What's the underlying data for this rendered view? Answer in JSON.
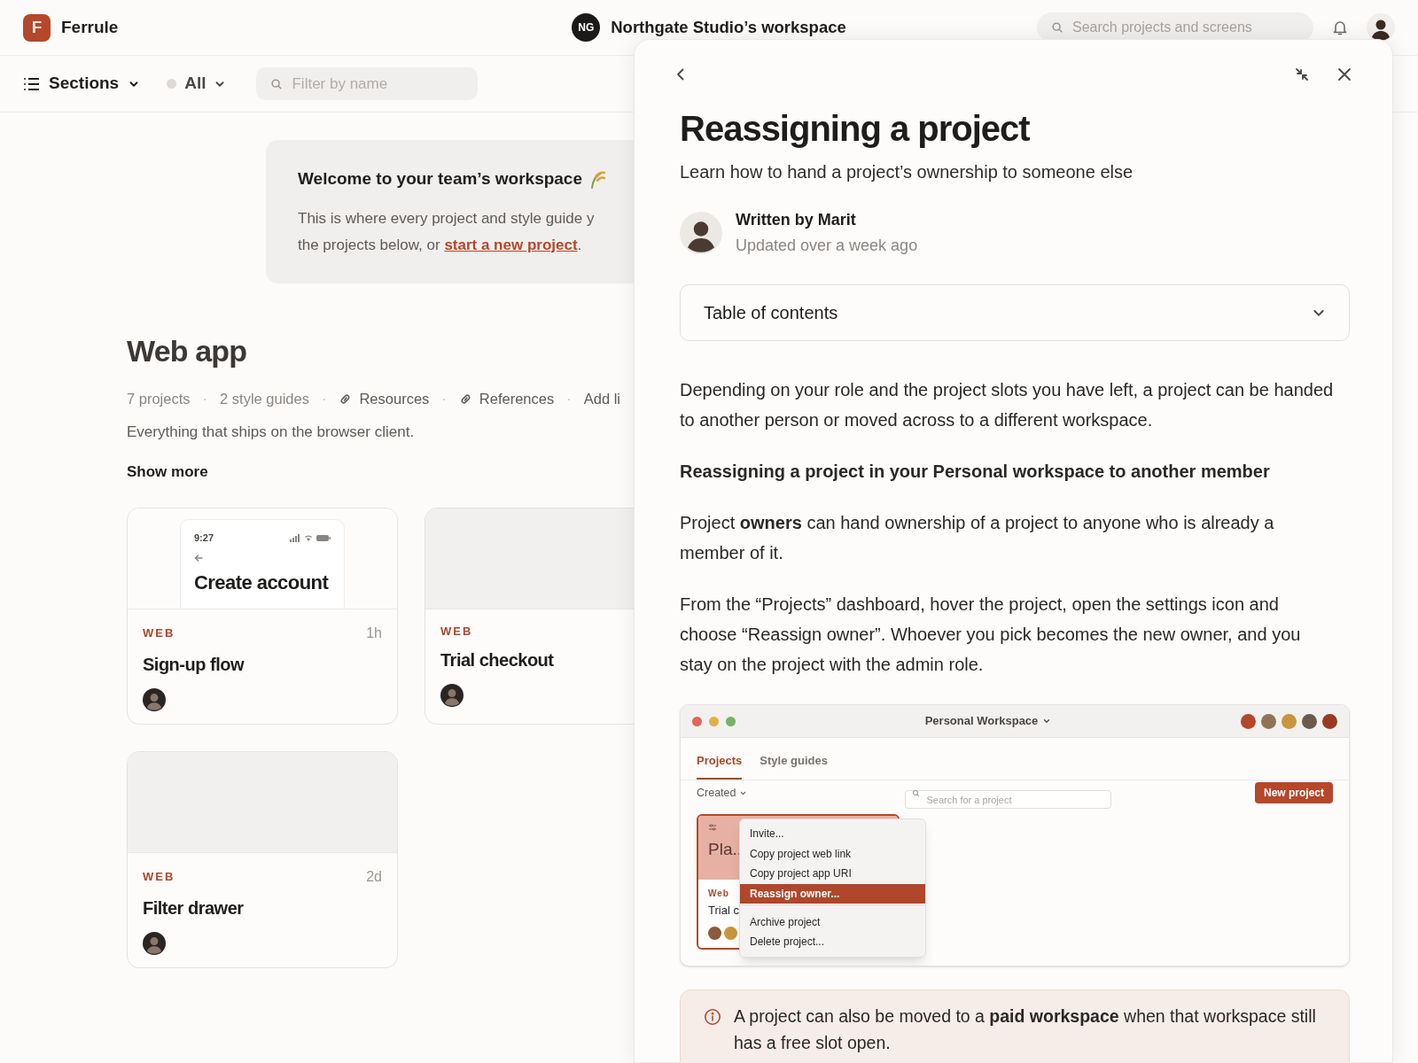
{
  "topbar": {
    "logo_letter": "F",
    "brand": "Ferrule",
    "workspace": {
      "initials": "NG",
      "name": "Northgate Studio’s workspace"
    },
    "search": {
      "placeholder": "Search projects and screens"
    }
  },
  "toolbar": {
    "sections": "Sections",
    "filter": "All",
    "filter_field": {
      "placeholder": "Filter by name"
    }
  },
  "welcome": {
    "title": "Welcome to your team’s workspace",
    "line_1": "This is where every project and style guide y",
    "line_2": "the projects below, or ",
    "link": "start a new project",
    "end": "."
  },
  "section": {
    "title": "Web app",
    "meta": [
      {
        "kind": "count",
        "text": "7 projects"
      },
      {
        "kind": "separator",
        "text": "·"
      },
      {
        "kind": "count",
        "text": "2 style guides"
      },
      {
        "kind": "separator",
        "text": "·"
      },
      {
        "kind": "link",
        "text": "Resources"
      },
      {
        "kind": "separator",
        "text": "·"
      },
      {
        "kind": "link",
        "text": "References"
      },
      {
        "kind": "separator",
        "text": "·"
      },
      {
        "kind": "action",
        "text": "Add li"
      }
    ],
    "description": "Everything that ships on the browser client.",
    "show_more": "Show more"
  },
  "cards": [
    {
      "tag": "WEB",
      "age": "1h",
      "title": "Sign-up flow",
      "preview": {
        "kind": "phone",
        "time": "9:27",
        "heading": "Create account"
      }
    },
    {
      "tag": "WEB",
      "title": "Trial checkout",
      "preview": {
        "kind": "blank"
      }
    },
    {
      "tag": "WEB",
      "age": "2d",
      "title": "Filter drawer",
      "preview": {
        "kind": "blank"
      }
    }
  ],
  "panel": {
    "title": "Reassigning a project",
    "subtitle": "Learn how to hand a project’s ownership to someone else",
    "author": {
      "byline": "Written by Marit",
      "updated": "Updated over a week ago"
    },
    "toc": {
      "label": "Table of contents",
      "expanded": false
    },
    "blocks": [
      {
        "kind": "p",
        "text": "Depending on your role and the project slots you have left, a project can be handed to another person or moved across to a different workspace."
      },
      {
        "kind": "h",
        "text": "Reassigning a project in your Personal workspace to another member"
      },
      {
        "kind": "p",
        "text": "Project **owners** can hand ownership of a project to anyone who is already a member of it."
      },
      {
        "kind": "p",
        "text": "From the “Projects” dashboard, hover the project, open the settings icon and choose “Reassign owner”. Whoever you pick becomes the new owner, and you stay on the project with the admin role."
      },
      {
        "kind": "screenshot"
      }
    ],
    "screenshot": {
      "title": "Personal Workspace",
      "members": [
        {
          "color": "#b5472a"
        },
        {
          "color": "#8f7555"
        },
        {
          "color": "#c9953d"
        },
        {
          "color": "#6b5a4c"
        },
        {
          "color": "#9a3a22"
        }
      ],
      "tabs": [
        {
          "label": "Projects",
          "selected": true
        },
        {
          "label": "Style guides",
          "selected": false
        }
      ],
      "sort": "Created",
      "search": {
        "placeholder": "Search for a project"
      },
      "button": "New project",
      "card": {
        "title": "Pla..",
        "tag": "Web",
        "name": "Trial c",
        "members": [
          {
            "color": "#8a5a3a"
          },
          {
            "color": "#c9953d"
          }
        ]
      },
      "menu": [
        {
          "label": "Invite...",
          "selected": false,
          "divider_before": false
        },
        {
          "label": "Copy project web link",
          "selected": false,
          "divider_before": false
        },
        {
          "label": "Copy project app URI",
          "selected": false,
          "divider_before": false
        },
        {
          "label": "Reassign owner...",
          "selected": true,
          "divider_before": false
        },
        {
          "label": "Archive project",
          "selected": false,
          "divider_before": true
        },
        {
          "label": "Delete project...",
          "selected": false,
          "divider_before": false
        }
      ]
    },
    "callout": "A project can also be moved to a **paid workspace** when that workspace still has a free slot open."
  }
}
